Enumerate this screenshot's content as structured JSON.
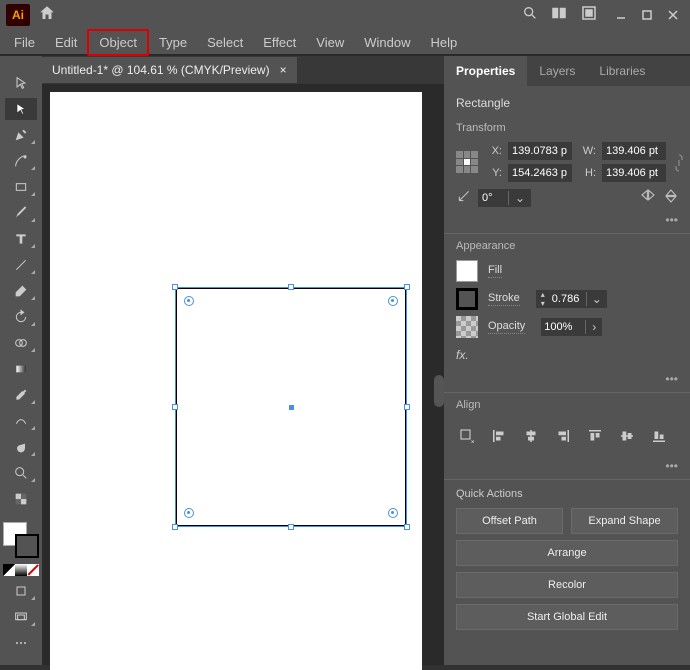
{
  "title_bar": {
    "logo": "Ai"
  },
  "menu": {
    "file": "File",
    "edit": "Edit",
    "object": "Object",
    "type": "Type",
    "select": "Select",
    "effect": "Effect",
    "view": "View",
    "window": "Window",
    "help": "Help"
  },
  "doc_tab": {
    "title": "Untitled-1* @ 104.61 % (CMYK/Preview)",
    "close": "×"
  },
  "panel_tabs": {
    "properties": "Properties",
    "layers": "Layers",
    "libraries": "Libraries"
  },
  "props": {
    "shape": "Rectangle",
    "transform_title": "Transform",
    "x_label": "X:",
    "y_label": "Y:",
    "w_label": "W:",
    "h_label": "H:",
    "x": "139.0783 p",
    "y": "154.2463 p",
    "w": "139.406 pt",
    "h": "139.406 pt",
    "angle": "0°",
    "more": "•••",
    "appearance_title": "Appearance",
    "fill_label": "Fill",
    "stroke_label": "Stroke",
    "stroke_weight": "0.786",
    "opacity_label": "Opacity",
    "opacity": "100%",
    "fx": "fx.",
    "align_title": "Align",
    "qa_title": "Quick Actions",
    "qa_offset": "Offset Path",
    "qa_expand": "Expand Shape",
    "qa_arrange": "Arrange",
    "qa_recolor": "Recolor",
    "qa_global": "Start Global Edit"
  }
}
